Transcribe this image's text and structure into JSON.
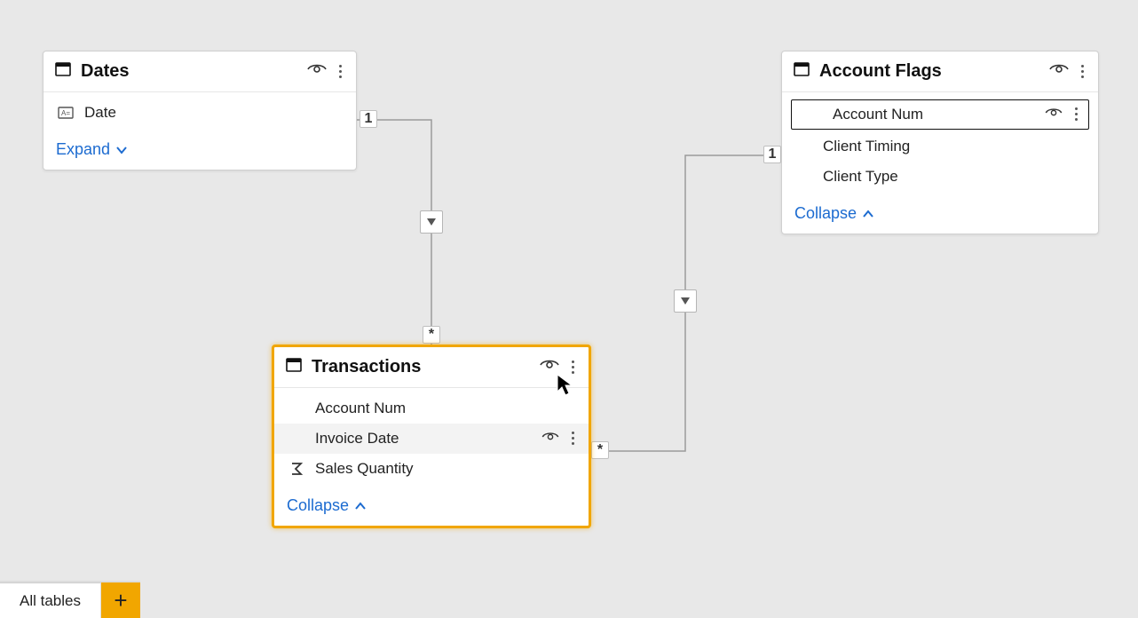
{
  "accent": "#1c6bd0",
  "selection": "#f1a600",
  "tables": {
    "dates": {
      "title": "Dates",
      "fields": [
        {
          "name": "Date",
          "type_icon": "text-field-icon"
        }
      ],
      "toggle": "Expand"
    },
    "transactions": {
      "title": "Transactions",
      "fields": [
        {
          "name": "Account Num"
        },
        {
          "name": "Invoice Date"
        },
        {
          "name": "Sales Quantity",
          "type_icon": "sigma-icon"
        }
      ],
      "toggle": "Collapse"
    },
    "account_flags": {
      "title": "Account Flags",
      "fields": [
        {
          "name": "Account Num"
        },
        {
          "name": "Client Timing"
        },
        {
          "name": "Client Type"
        }
      ],
      "toggle": "Collapse"
    }
  },
  "relationships": {
    "dates_to_transactions": {
      "from_card": "1",
      "to_card": "*"
    },
    "flags_to_transactions": {
      "from_card": "1",
      "to_card": "*"
    }
  },
  "bottom_bar": {
    "tab": "All tables",
    "add": "+"
  }
}
